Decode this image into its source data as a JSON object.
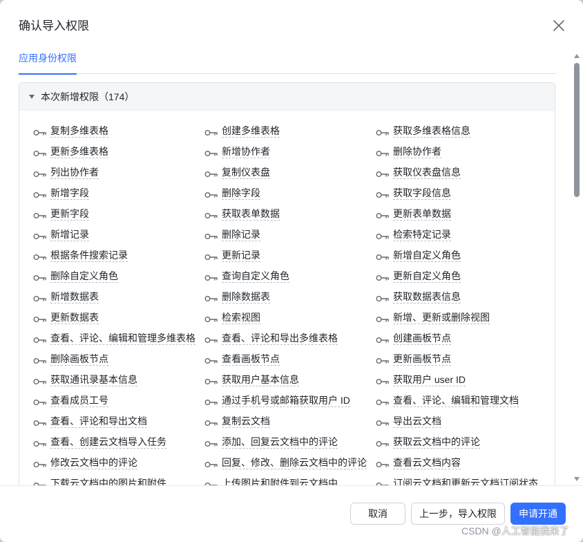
{
  "dialog": {
    "title": "确认导入权限",
    "close_icon": "close-icon"
  },
  "tabs": [
    {
      "label": "应用身份权限",
      "active": true
    }
  ],
  "section": {
    "title": "本次新增权限（174）",
    "expanded": true
  },
  "permissions": [
    "复制多维表格",
    "创建多维表格",
    "获取多维表格信息",
    "更新多维表格",
    "新增协作者",
    "删除协作者",
    "列出协作者",
    "复制仪表盘",
    "获取仪表盘信息",
    "新增字段",
    "删除字段",
    "获取字段信息",
    "更新字段",
    "获取表单数据",
    "更新表单数据",
    "新增记录",
    "删除记录",
    "检索特定记录",
    "根据条件搜索记录",
    "更新记录",
    "新增自定义角色",
    "删除自定义角色",
    "查询自定义角色",
    "更新自定义角色",
    "新增数据表",
    "删除数据表",
    "获取数据表信息",
    "更新数据表",
    "检索视图",
    "新增、更新或删除视图",
    "查看、评论、编辑和管理多维表格",
    "查看、评论和导出多维表格",
    "创建画板节点",
    "删除画板节点",
    "查看画板节点",
    "更新画板节点",
    "获取通讯录基本信息",
    "获取用户基本信息",
    "获取用户 user ID",
    "查看成员工号",
    "通过手机号或邮箱获取用户 ID",
    "查看、评论、编辑和管理文档",
    "查看、评论和导出文档",
    "复制云文档",
    "导出云文档",
    "查看、创建云文档导入任务",
    "添加、回复云文档中的评论",
    "获取云文档中的评论",
    "修改云文档中的评论",
    "回复、修改、删除云文档中的评论",
    "查看云文档内容",
    "下载云文档中的图片和附件",
    "上传图片和附件到云文档中",
    "订阅云文档和更新云文档订阅状态"
  ],
  "footer": {
    "cancel_label": "取消",
    "back_label": "上一步，导入权限",
    "apply_label": "申请开通"
  },
  "watermark": {
    "prefix": "CSDN @",
    "name": "人工智能我来了"
  },
  "colors": {
    "primary": "#3370ff",
    "text": "#1f2329",
    "icon": "#646a73"
  }
}
